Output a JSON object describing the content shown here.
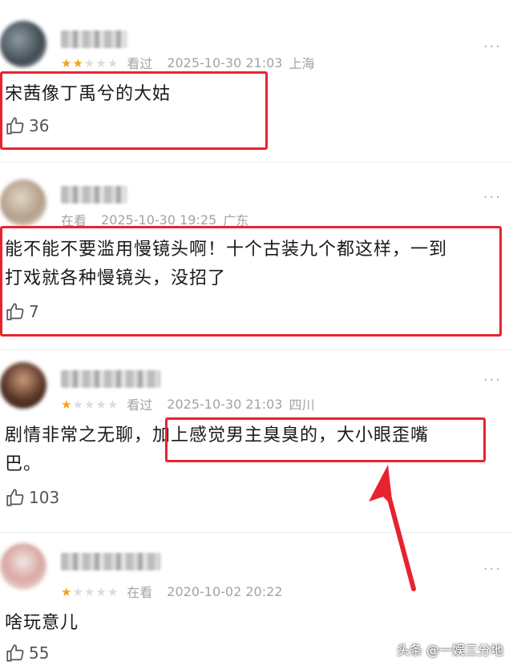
{
  "reviews": [
    {
      "rating": 2,
      "status": "看过",
      "datetime": "2025-10-30 21:03",
      "location": "上海",
      "content": "宋茜像丁禹兮的大姑",
      "likes": "36"
    },
    {
      "rating": 0,
      "status": "在看",
      "datetime": "2025-10-30 19:25",
      "location": "广东",
      "content_line1": "能不能不要滥用慢镜头啊！十个古装九个都这样，一到",
      "content_line2": "打戏就各种慢镜头，没招了",
      "likes": "7"
    },
    {
      "rating": 1,
      "status": "看过",
      "datetime": "2025-10-30 21:03",
      "location": "四川",
      "content_part1": "剧情非常之无聊，",
      "content_part2": "加上感觉男主臭臭的，大小眼歪嘴",
      "content_line2": "巴。",
      "likes": "103"
    },
    {
      "rating": 1,
      "status": "在看",
      "datetime": "2020-10-02 20:22",
      "location": "",
      "content": "啥玩意儿",
      "likes": "55"
    }
  ],
  "icons": {
    "star": "star-icon",
    "like": "thumbs-up-icon",
    "more": "more-dots-icon"
  },
  "colors": {
    "highlight": "#e8232f",
    "star_on": "#f0a41a",
    "star_off": "#dcdcdc"
  },
  "watermark": "头条 @一娱三分地"
}
